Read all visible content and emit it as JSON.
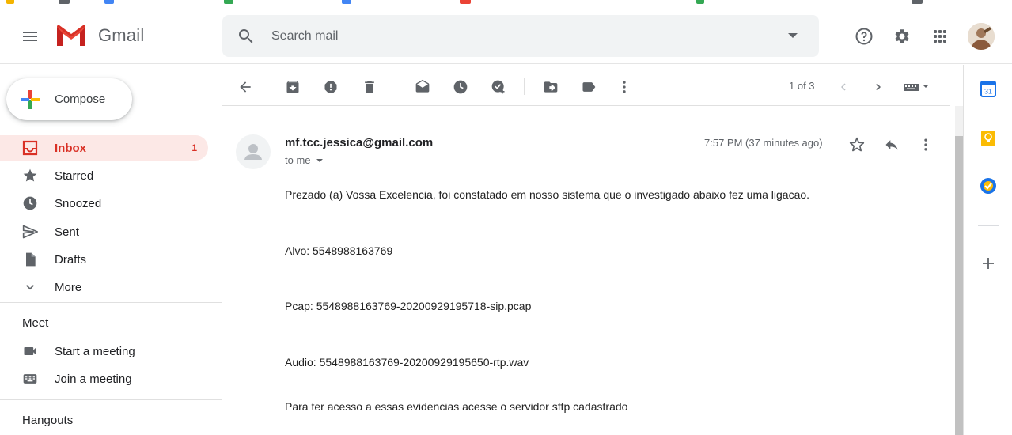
{
  "header": {
    "app_name": "Gmail",
    "search_placeholder": "Search mail",
    "icons": [
      "menu-icon",
      "search-icon",
      "dropdown-icon",
      "help-icon",
      "settings-icon",
      "apps-icon"
    ]
  },
  "sidebar": {
    "compose_label": "Compose",
    "items": [
      {
        "label": "Inbox",
        "count": "1",
        "icon": "inbox-icon",
        "active": true
      },
      {
        "label": "Starred",
        "icon": "star-icon"
      },
      {
        "label": "Snoozed",
        "icon": "clock-icon"
      },
      {
        "label": "Sent",
        "icon": "send-icon"
      },
      {
        "label": "Drafts",
        "icon": "draft-icon"
      },
      {
        "label": "More",
        "icon": "chevron-down-icon"
      }
    ],
    "meet": {
      "title": "Meet",
      "items": [
        {
          "label": "Start a meeting",
          "icon": "video-icon"
        },
        {
          "label": "Join a meeting",
          "icon": "keyboard-icon"
        }
      ]
    },
    "hangouts_title": "Hangouts"
  },
  "toolbar": {
    "pager": "1 of 3"
  },
  "message": {
    "sender": "mf.tcc.jessica@gmail.com",
    "to": "to me",
    "timestamp": "7:57 PM (37 minutes ago)",
    "body": [
      "Prezado (a) Vossa Excelencia, foi constatado em nosso sistema que o investigado abaixo fez uma ligacao.",
      "Alvo: 5548988163769",
      "Pcap: 5548988163769-20200929195718-sip.pcap",
      "Audio: 5548988163769-20200929195650-rtp.wav",
      "Para ter acesso a essas evidencias acesse o servidor sftp cadastrado"
    ]
  },
  "colors": {
    "accent_red": "#d93025",
    "active_bg": "#fce8e6",
    "icon_gray": "#5f6368",
    "calendar_blue": "#1a73e8",
    "keep_yellow": "#fbbc04"
  }
}
